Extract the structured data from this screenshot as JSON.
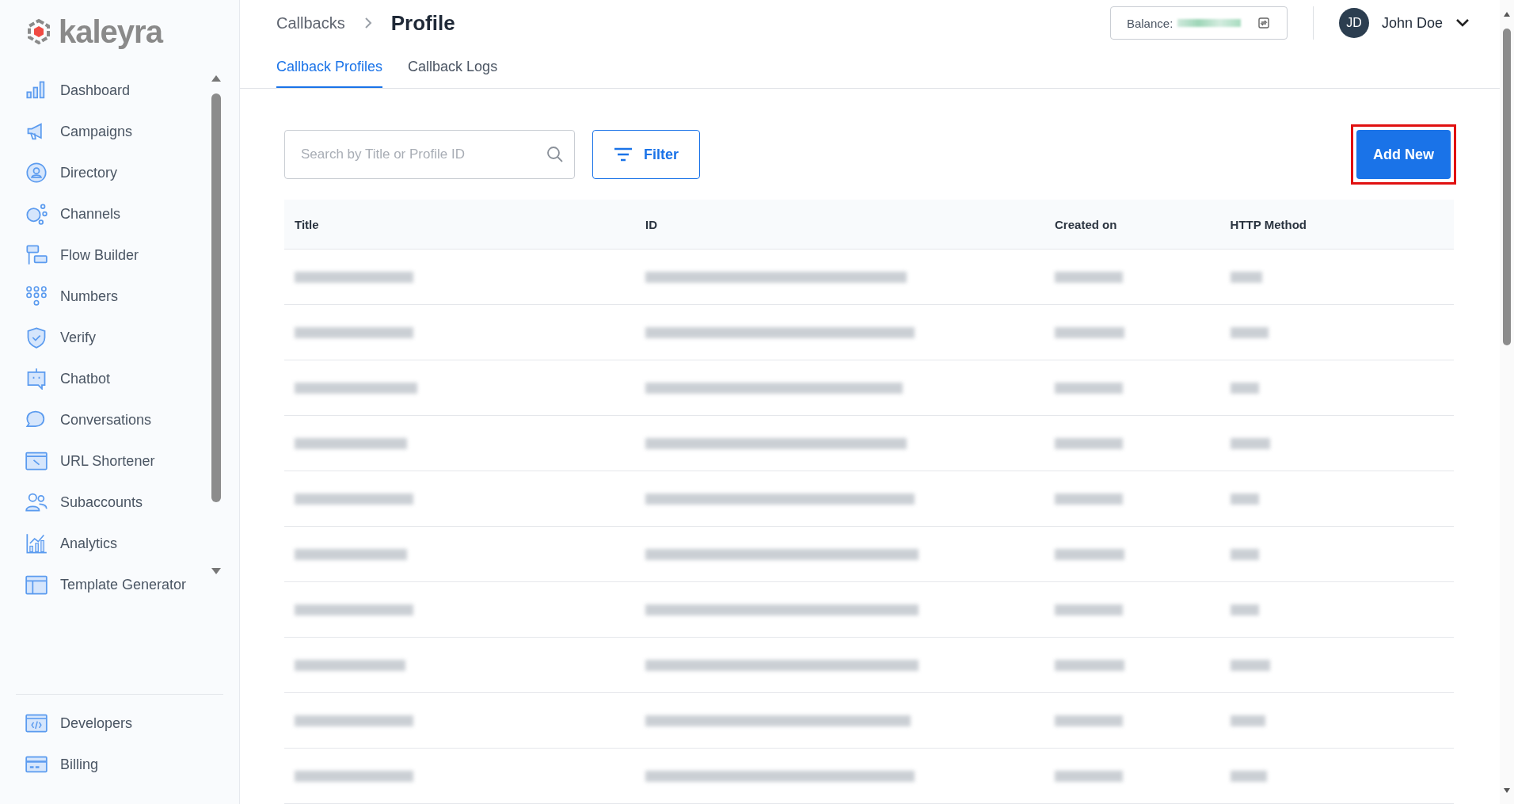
{
  "sidebar": {
    "logo": "kaleyra",
    "items": [
      {
        "label": "Dashboard",
        "selected": false
      },
      {
        "label": "Campaigns",
        "selected": false
      },
      {
        "label": "Directory",
        "selected": false
      },
      {
        "label": "Channels",
        "selected": false
      },
      {
        "label": "Flow Builder",
        "selected": false
      },
      {
        "label": "Numbers",
        "selected": false
      },
      {
        "label": "Verify",
        "selected": false
      },
      {
        "label": "Chatbot",
        "selected": false
      },
      {
        "label": "Conversations",
        "selected": false
      },
      {
        "label": "URL Shortener",
        "selected": false
      },
      {
        "label": "Subaccounts",
        "selected": false
      },
      {
        "label": "Analytics",
        "selected": false
      },
      {
        "label": "Template Generator",
        "selected": false
      }
    ],
    "bottom_items": [
      {
        "label": "Developers",
        "selected": false
      },
      {
        "label": "Billing",
        "selected": false
      }
    ]
  },
  "header": {
    "breadcrumb": [
      "Callbacks",
      "Profile"
    ],
    "balance": {
      "label": "Balance:",
      "value_blurred": true
    },
    "user": {
      "initials": "JD",
      "name": "John Doe"
    }
  },
  "tabs": [
    {
      "label": "Callback Profiles",
      "selected": true
    },
    {
      "label": "Callback Logs",
      "selected": false
    }
  ],
  "toolbar": {
    "search": {
      "placeholder": "Search by Title or Profile ID"
    },
    "filter": "Filter",
    "add_button": {
      "label": "Add New",
      "highlighted": true
    }
  },
  "table": {
    "columns": [
      "Title",
      "ID",
      "Created on",
      "HTTP Method"
    ],
    "rows": [
      {
        "blurred": true
      },
      {
        "blurred": true
      },
      {
        "blurred": true
      },
      {
        "blurred": true
      },
      {
        "blurred": true
      },
      {
        "blurred": true
      },
      {
        "blurred": true
      },
      {
        "blurred": true
      },
      {
        "blurred": true
      },
      {
        "blurred": true
      }
    ]
  }
}
